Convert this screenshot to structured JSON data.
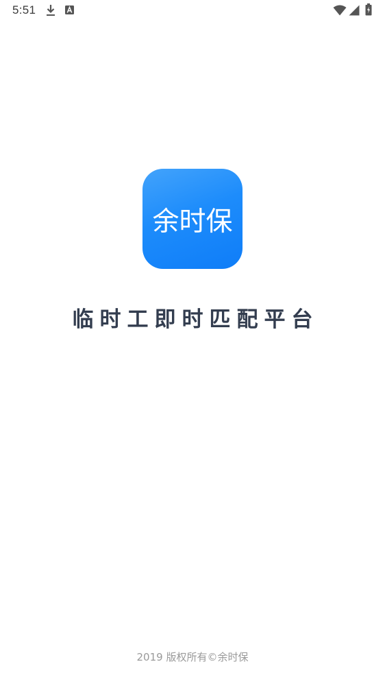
{
  "status_bar": {
    "time": "5:51",
    "icons": [
      "download-icon",
      "a-box-icon",
      "wifi-icon",
      "signal-icon",
      "battery-icon"
    ]
  },
  "splash": {
    "logo_text": "余时保",
    "logo_color": "#1d8cfb",
    "tagline": "临时工即时匹配平台",
    "copyright": "2019 版权所有©余时保"
  }
}
